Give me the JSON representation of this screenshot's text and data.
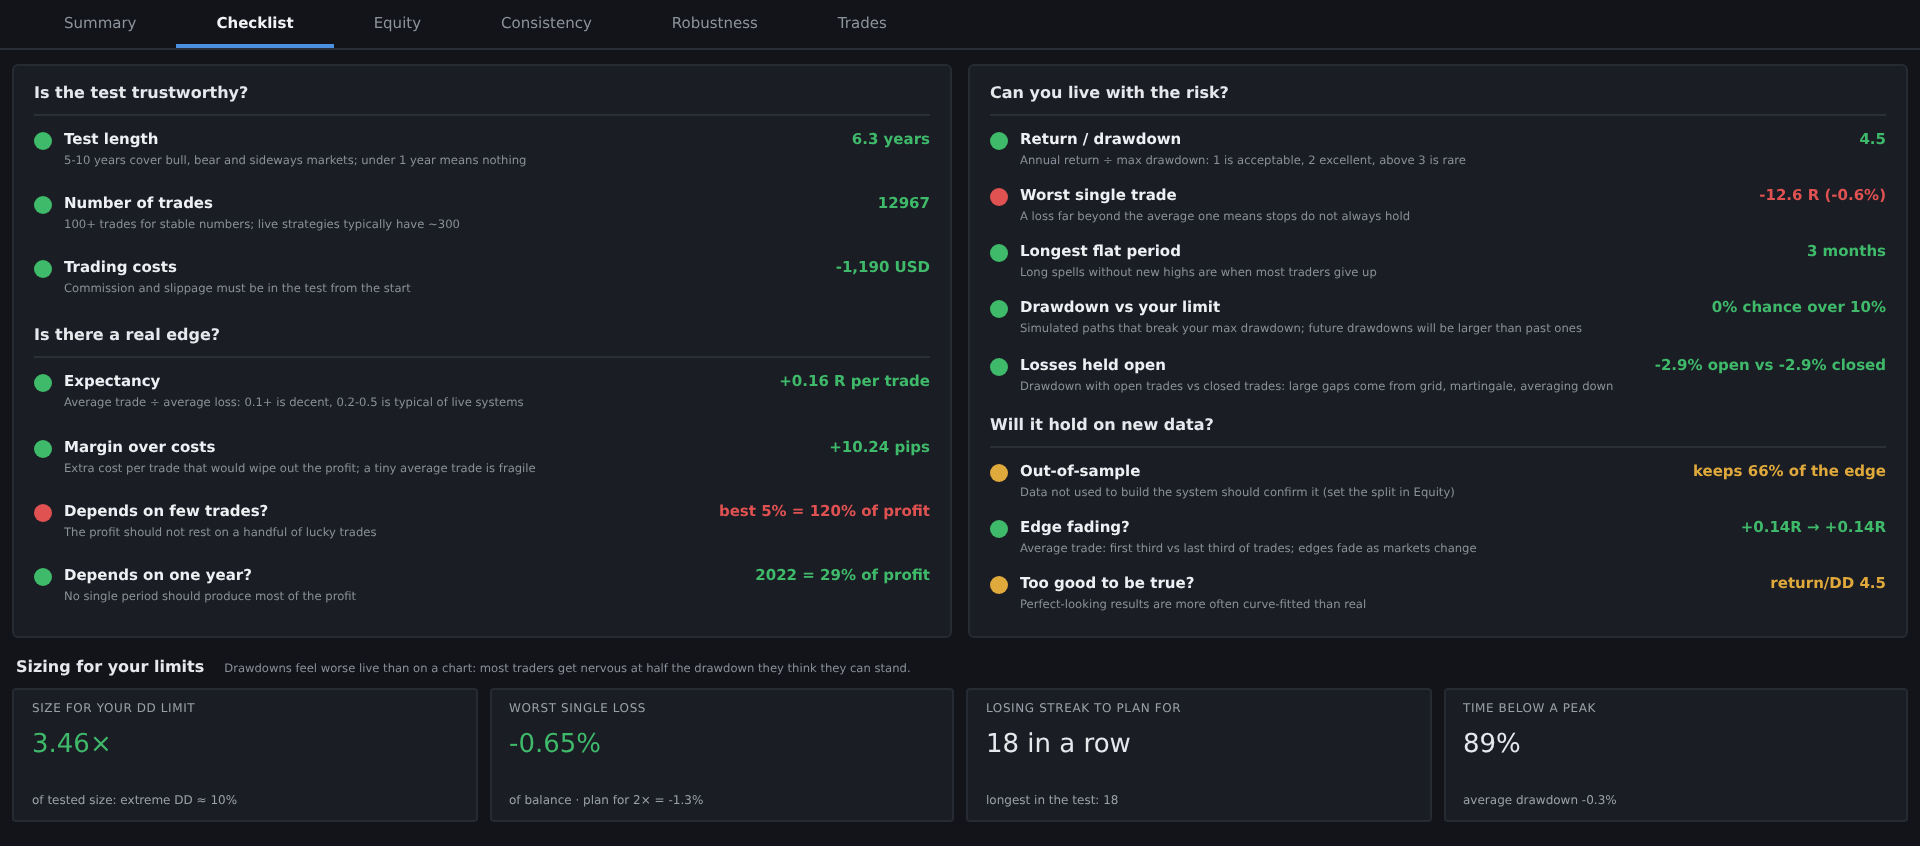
{
  "tabs": [
    {
      "label": "Summary",
      "selected": false
    },
    {
      "label": "Checklist",
      "selected": true
    },
    {
      "label": "Equity",
      "selected": false
    },
    {
      "label": "Consistency",
      "selected": false
    },
    {
      "label": "Robustness",
      "selected": false
    },
    {
      "label": "Trades",
      "selected": false
    }
  ],
  "panels": [
    {
      "sections": [
        {
          "title": "Is the test trustworthy?",
          "items": [
            {
              "label": "Test length",
              "value": "6.3 years",
              "description": "5-10 years cover bull, bear and sideways markets; under 1 year means nothing",
              "color": "#3fb96a"
            },
            {
              "label": "Number of trades",
              "value": "12967",
              "description": "100+ trades for stable numbers; live strategies typically have ~300",
              "color": "#3fb96a"
            },
            {
              "label": "Trading costs",
              "value": "-1,190 USD",
              "description": "Commission and slippage must be in the test from the start",
              "color": "#3fb96a"
            }
          ]
        },
        {
          "title": "Is there a real edge?",
          "items": [
            {
              "label": "Expectancy",
              "value": "+0.16 R per trade",
              "description": "Average trade ÷ average loss: 0.1+ is decent, 0.2-0.5 is typical of live systems",
              "color": "#3fb96a"
            },
            {
              "label": "Margin over costs",
              "value": "+10.24 pips",
              "description": "Extra cost per trade that would wipe out the profit; a tiny average trade is fragile",
              "color": "#3fb96a"
            },
            {
              "label": "Depends on few trades?",
              "value": "best 5% = 120% of profit",
              "description": "The profit should not rest on a handful of lucky trades",
              "color": "#e05252"
            },
            {
              "label": "Depends on one year?",
              "value": "2022 = 29% of profit",
              "description": "No single period should produce most of the profit",
              "color": "#3fb96a"
            }
          ]
        }
      ]
    },
    {
      "sections": [
        {
          "title": "Can you live with the risk?",
          "items": [
            {
              "label": "Return / drawdown",
              "value": "4.5",
              "description": "Annual return ÷ max drawdown: 1 is acceptable, 2 excellent, above 3 is rare",
              "color": "#3fb96a"
            },
            {
              "label": "Worst single trade",
              "value": "-12.6 R  (-0.6%)",
              "description": "A loss far beyond the average one means stops do not always hold",
              "color": "#e05252"
            },
            {
              "label": "Longest flat period",
              "value": "3 months",
              "description": "Long spells without new highs are when most traders give up",
              "color": "#3fb96a"
            },
            {
              "label": "Drawdown vs your limit",
              "value": "0% chance over 10%",
              "description": "Simulated paths that break your max drawdown; future drawdowns will be larger than past ones",
              "color": "#3fb96a"
            },
            {
              "label": "Losses held open",
              "value": "-2.9% open vs -2.9% closed",
              "description": "Drawdown with open trades vs closed trades: large gaps come from grid, martingale, averaging down",
              "color": "#3fb96a"
            }
          ]
        },
        {
          "title": "Will it hold on new data?",
          "items": [
            {
              "label": "Out-of-sample",
              "value": "keeps 66% of the edge",
              "description": "Data not used to build the system should confirm it (set the split in Equity)",
              "color": "#e0a93b"
            },
            {
              "label": "Edge fading?",
              "value": "+0.14R  →  +0.14R",
              "description": "Average trade: first third vs last third of trades; edges fade as markets change",
              "color": "#3fb96a"
            },
            {
              "label": "Too good to be true?",
              "value": "return/DD 4.5",
              "description": "Perfect-looking results are more often curve-fitted than real",
              "color": "#e0a93b"
            }
          ]
        }
      ]
    }
  ],
  "sizing": {
    "title": "Sizing for your limits",
    "note": "Drawdowns feel worse live than on a chart: most traders get nervous at half the drawdown they think they can stand.",
    "cards": [
      {
        "label": "SIZE FOR YOUR DD LIMIT",
        "value": "3.46×",
        "detail": "of tested size: extreme DD ≈ 10%",
        "color": "#3fb96a"
      },
      {
        "label": "WORST SINGLE LOSS",
        "value": "-0.65%",
        "detail": "of balance  ·  plan for 2× = -1.3%",
        "color": "#3fb96a"
      },
      {
        "label": "LOSING STREAK TO PLAN FOR",
        "value": "18 in a row",
        "detail": "longest in the test: 18",
        "color": "#e6e8ec"
      },
      {
        "label": "TIME BELOW A PEAK",
        "value": "89%",
        "detail": "average drawdown -0.3%",
        "color": "#e6e8ec"
      }
    ]
  }
}
